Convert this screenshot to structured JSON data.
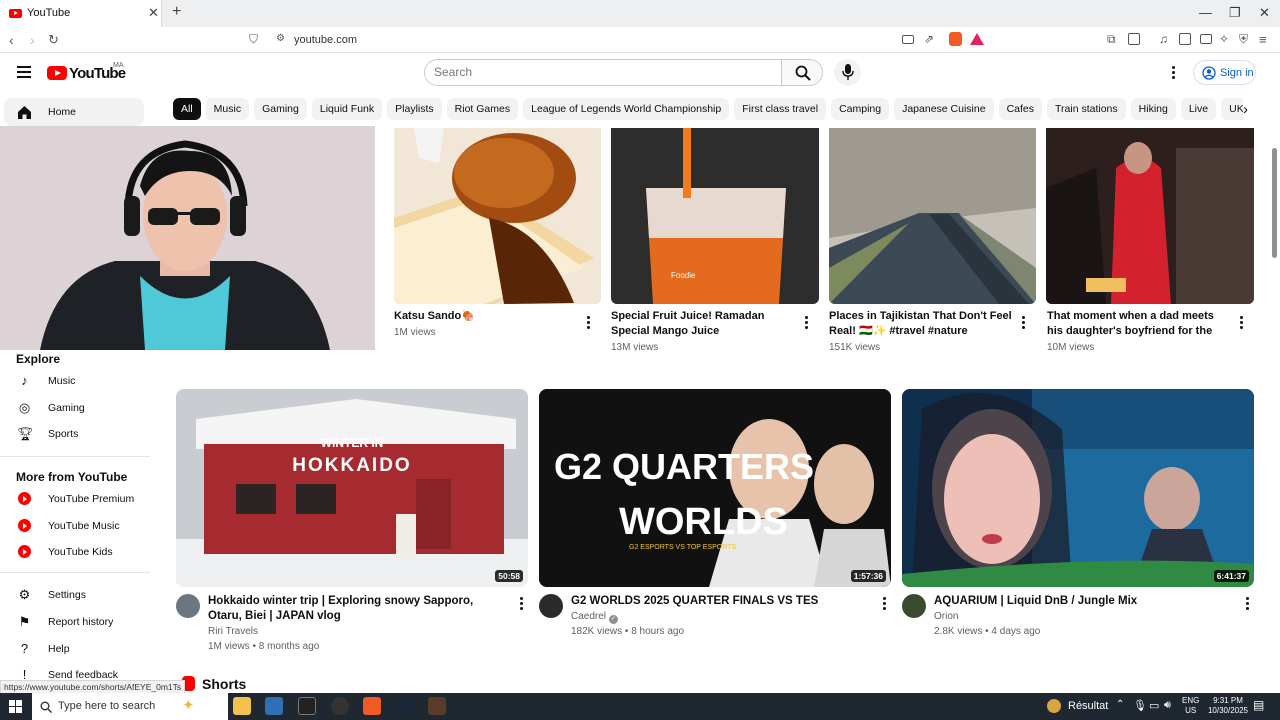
{
  "browser": {
    "tab_title": "YouTube",
    "url": "youtube.com",
    "status_url": "https://www.youtube.com/shorts/AfEYE_0m1Ts"
  },
  "header": {
    "logo_text": "YouTube",
    "country_code": "MA",
    "search_placeholder": "Search",
    "sign_in_label": "Sign in"
  },
  "chips": [
    "All",
    "Music",
    "Gaming",
    "Liquid Funk",
    "Playlists",
    "Riot Games",
    "League of Legends World Championship",
    "First class travel",
    "Camping",
    "Japanese Cuisine",
    "Cafes",
    "Train stations",
    "Hiking",
    "Live",
    "UK Garage"
  ],
  "sidebar": {
    "home_label": "Home",
    "explore_heading": "Explore",
    "explore_items": [
      "Music",
      "Gaming",
      "Sports"
    ],
    "more_heading": "More from YouTube",
    "more_items": [
      "YouTube Premium",
      "YouTube Music",
      "YouTube Kids"
    ],
    "footer_items": [
      "Settings",
      "Report history",
      "Help",
      "Send feedback"
    ]
  },
  "top_videos": [
    {
      "title": "Katsu Sando🍖",
      "views": "1M views"
    },
    {
      "title": "Special Fruit Juice! Ramadan Special Mango Juice",
      "views": "13M views"
    },
    {
      "title": "Places in Tajikistan That Don't Feel Real! 🇹🇯✨ #travel #nature #adventur...",
      "views": "151K views"
    },
    {
      "title": "That moment when a dad meets his daughter's boyfriend for the first ...",
      "views": "10M views"
    }
  ],
  "videos": [
    {
      "title": "Hokkaido winter trip | Exploring snowy Sapporo, Otaru, Biei | JAPAN vlog",
      "channel": "Riri Travels",
      "meta": "1M views • 8 months ago",
      "duration": "50:58",
      "thumb_text_1": "WINTER IN",
      "thumb_text_2": "HOKKAIDO"
    },
    {
      "title": "G2 WORLDS 2025 QUARTER FINALS VS TES",
      "channel": "Caedrel",
      "meta": "182K views • 8 hours ago",
      "duration": "1:57:36",
      "thumb_text_1": "G2 QUARTERS",
      "thumb_text_2": "WORLDS",
      "thumb_text_3": "G2 ESPORTS VS TOP ESPORTS"
    },
    {
      "title": "AQUARIUM | Liquid DnB / Jungle Mix",
      "channel": "Orion",
      "meta": "2.8K views • 4 days ago",
      "duration": "6:41:37"
    }
  ],
  "shorts_label": "Shorts",
  "taskbar": {
    "search_placeholder": "Type here to search",
    "weather": "Résultat",
    "lang_1": "ENG",
    "lang_2": "US",
    "time": "9:31 PM",
    "date": "10/30/2025"
  },
  "colors": {
    "brand_red": "#ff0000",
    "link_blue": "#065fd4",
    "taskbar": "#1f2730"
  }
}
